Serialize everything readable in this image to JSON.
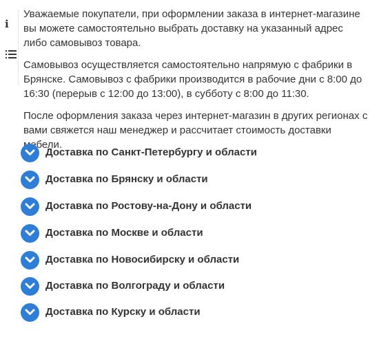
{
  "paragraphs": [
    "Уважаемые покупатели, при оформлении заказа в интернет-магазине вы можете самостоятельно выбрать доставку на указанный адрес либо самовывоз товара.",
    "Самовывоз осуществляется самостоятельно напрямую с фабрики в Брянске. Самовывоз с фабрики производится в рабочие дни с 8:00 до 16:30 (перерыв с 12:00 до 13:00), в субботу с 8:00 до 11:30.",
    "После оформления заказа через интернет-магазин в других регионах с вами свяжется наш менеджер и рассчитает стоимость доставки мебели."
  ],
  "accordion": [
    {
      "label": "Доставка по Санкт-Петербургу и области"
    },
    {
      "label": "Доставка по Брянску и области"
    },
    {
      "label": "Доставка по Ростову-на-Дону и области"
    },
    {
      "label": "Доставка по Москве и области"
    },
    {
      "label": "Доставка по Новосибирску и области"
    },
    {
      "label": "Доставка по Волгограду и области"
    },
    {
      "label": "Доставка по Курску и области"
    }
  ],
  "icons": {
    "info": "info-icon",
    "list": "list-icon",
    "chevron": "chevron-down-icon"
  },
  "colors": {
    "accent": "#2e7ed8",
    "text": "#333333"
  }
}
